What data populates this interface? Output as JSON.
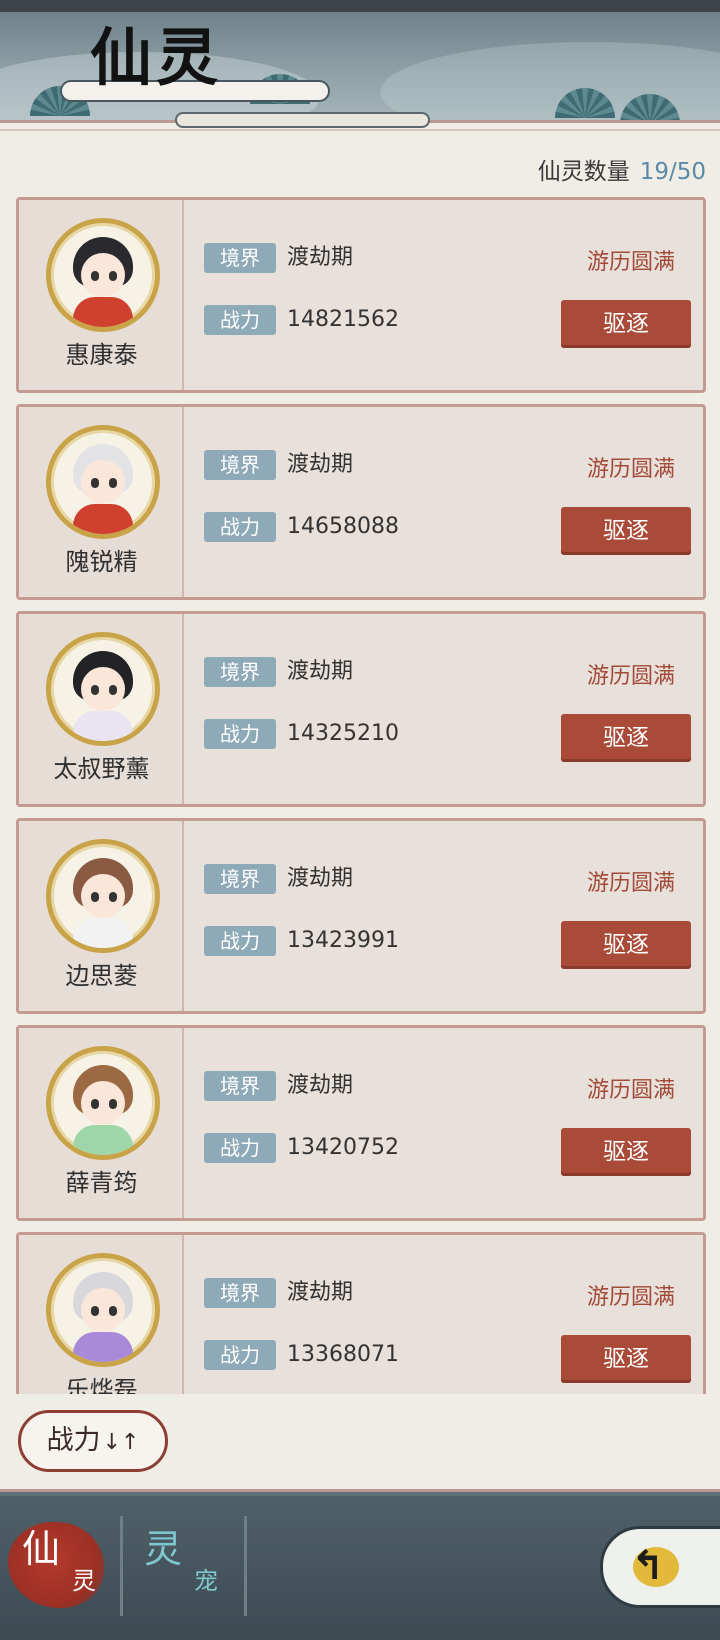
{
  "header": {
    "title": "仙灵"
  },
  "count": {
    "label": "仙灵数量",
    "value": "19/50"
  },
  "tag_labels": {
    "realm": "境界",
    "power": "战力"
  },
  "colors": {
    "accent_red": "#a94b38",
    "tag_blue": "#8eaab8",
    "count_blue": "#5a8aa6",
    "status_red": "#a24a38"
  },
  "spirits": [
    {
      "name": "惠康泰",
      "realm": "渡劫期",
      "power": "14821562",
      "status": "游历圆满",
      "action": "驱逐",
      "hair": "#2a2a2e",
      "outfit": "#d0402e"
    },
    {
      "name": "隗锐精",
      "realm": "渡劫期",
      "power": "14658088",
      "status": "游历圆满",
      "action": "驱逐",
      "hair": "#e3e3e6",
      "outfit": "#d0402e"
    },
    {
      "name": "太叔野薰",
      "realm": "渡劫期",
      "power": "14325210",
      "status": "游历圆满",
      "action": "驱逐",
      "hair": "#232326",
      "outfit": "#e9e4f0"
    },
    {
      "name": "边思菱",
      "realm": "渡劫期",
      "power": "13423991",
      "status": "游历圆满",
      "action": "驱逐",
      "hair": "#8a5a43",
      "outfit": "#f2f2f2"
    },
    {
      "name": "薛青筠",
      "realm": "渡劫期",
      "power": "13420752",
      "status": "游历圆满",
      "action": "驱逐",
      "hair": "#9c6a42",
      "outfit": "#9fd6a9"
    },
    {
      "name": "乐烨磊",
      "realm": "渡劫期",
      "power": "13368071",
      "status": "游历圆满",
      "action": "驱逐",
      "hair": "#d8d8dc",
      "outfit": "#a98ad8"
    }
  ],
  "sort_button": {
    "label": "战力",
    "icon": "sort-arrows-icon",
    "arrows": "↓↑"
  },
  "tabs": [
    {
      "big": "仙",
      "small": "灵",
      "active": true
    },
    {
      "big": "灵",
      "small": "宠",
      "active": false
    }
  ],
  "back_button": {
    "icon": "return-arrow-icon",
    "glyph": "↰"
  }
}
